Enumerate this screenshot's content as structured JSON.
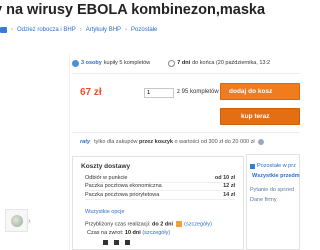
{
  "title": "y na wirusy EBOLA kombinezon,maska",
  "breadcrumbs": [
    "Odzież robocza i BHP",
    "Artykuły BHP",
    "Pozostałe"
  ],
  "stats": {
    "buyers_count": "3 osoby",
    "buyers_text": "kupiły 5 kompletów",
    "days_left": "7 dni",
    "end_text": "do końca (20 października, 13:2"
  },
  "buy": {
    "price": "67 zł",
    "qty_value": "1",
    "qty_of": "z 95 kompletów",
    "add_to_cart": "dodaj do kosz",
    "buy_now": "kup teraz"
  },
  "raty": {
    "logo": "raty",
    "text_pre": "tylko dla zakupów",
    "text_bold": "przez koszyk",
    "text_post": "o wartości od 300 zł do 20 000 zł"
  },
  "shipping": {
    "header": "Koszty dostawy",
    "rows": [
      {
        "name": "Odbiór w punkcie",
        "price": "od 10 zł"
      },
      {
        "name": "Paczka pocztowa ekonomiczna",
        "price": "12 zł"
      },
      {
        "name": "Paczka pocztowa priorytetowa",
        "price": "14 zł"
      }
    ],
    "more": "Wszystkie opcje",
    "time_label": "Przybliżony czas realizacji:",
    "time_value": "do 2 dni",
    "time_link": "(szczegóły)",
    "delivery_label": "Czas na zwrot:",
    "delivery_value": "10 dni",
    "delivery_link": "(szczegóły)"
  },
  "side": {
    "items": [
      {
        "label": "Pozostałe w prz"
      },
      {
        "label": "Wszystkie przedm"
      },
      {
        "label": "Pytanie do sprzed"
      },
      {
        "label": "Dane firmy"
      }
    ]
  },
  "colors": {
    "accent": "#f07c1e",
    "link": "#2a6ec9",
    "price": "#e8522a"
  }
}
